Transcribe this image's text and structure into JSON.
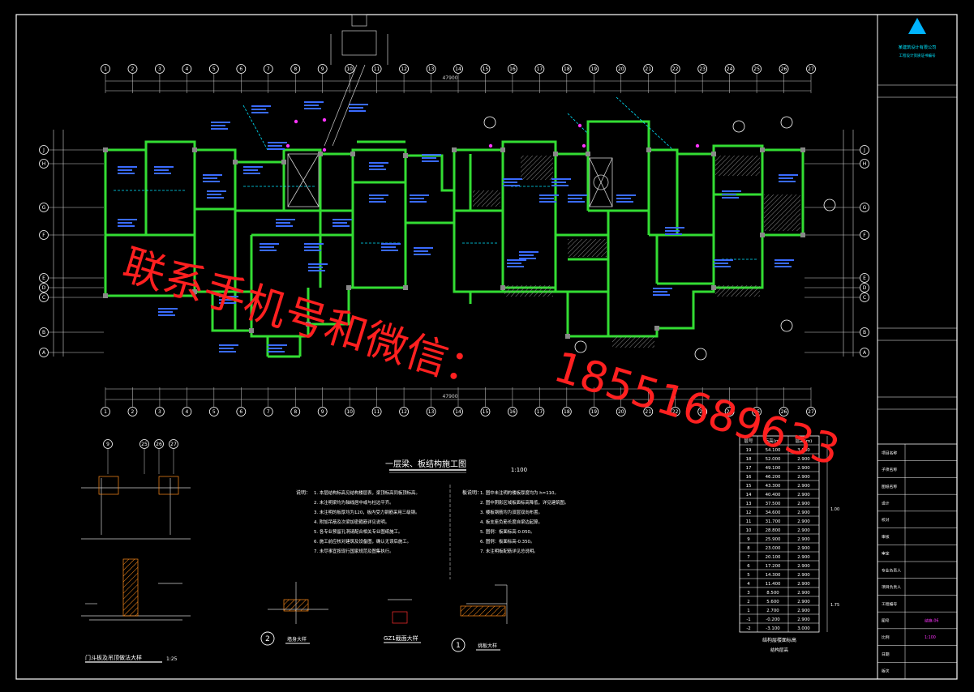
{
  "colors": {
    "background": "#000000",
    "frame": "#ffffff",
    "wall": "#33dd33",
    "dim": "#cfcfcf",
    "label": "#3a6bff",
    "grid_bubble": "#ffffff",
    "watermark": "#ff2020",
    "column": "#888888",
    "accent": "#ff33ff",
    "section_hatch": "#ff8c1a",
    "symbol": "#00e5ff"
  },
  "watermark": {
    "line1": "联系手机号和微信：",
    "line2": "18551689633"
  },
  "plan": {
    "title": "一层梁、板结构施工图",
    "scale": "1:100",
    "dim_total_top": "47900",
    "dim_total_bottom": "47900",
    "grid_top": [
      "1",
      "2",
      "3",
      "4",
      "5",
      "6",
      "7",
      "8",
      "9",
      "10",
      "11",
      "12",
      "13",
      "14",
      "15",
      "16",
      "17",
      "18",
      "19",
      "20",
      "21",
      "22",
      "23",
      "24",
      "25",
      "26",
      "27"
    ],
    "grid_bottom": [
      "1",
      "2",
      "3",
      "4",
      "5",
      "6",
      "7",
      "8",
      "9",
      "10",
      "11",
      "12",
      "13",
      "14",
      "15",
      "16",
      "17",
      "18",
      "19",
      "20",
      "21",
      "22",
      "23",
      "24",
      "25",
      "26",
      "27"
    ],
    "grid_side": [
      "J",
      "H",
      "G",
      "F",
      "E",
      "D",
      "C",
      "B",
      "A"
    ]
  },
  "notes": {
    "left_head": "说明：",
    "left": [
      "1. 本层结构标高见结构楼层表，梁顶标高同板顶标高。",
      "2. 未注明梁均为轴线居中或与柱边平齐。",
      "3. 未注明的板厚均为120，板内受力钢筋采用三级钢。",
      "4. 附加吊筋及次梁加密箍筋详见说明。",
      "5. 各专业预留孔洞请配合相关专业图纸施工。",
      "6. 施工前应核对建筑及设备图，确认无误后施工。",
      "7. 未尽事宜按现行国家规范及图集执行。"
    ],
    "right_head": "板说明：",
    "right": [
      "1. 图中未注明的楼板厚度均为 h=110。",
      "2. 图中阴影区域板面标高降低，详见建筑图。",
      "3. 楼板钢筋均为双层双向布置。",
      "4. 板支座负筋长度自梁边起算。",
      "5. 图例：板面标高-0.050。",
      "6. 图例：板面标高-0.350。",
      "7. 未注明板配筋详见总说明。"
    ]
  },
  "details": [
    {
      "num": "2",
      "label": "墙身大样"
    },
    {
      "num": "",
      "label": "GZ1截面大样"
    },
    {
      "num": "1",
      "label": "挑板大样"
    }
  ],
  "detail_left_label": "门斗板及吊顶做法大样",
  "detail_left_scale": "1:25",
  "detail_left_dims": [
    "9",
    "25",
    "26",
    "27"
  ],
  "floor_table": {
    "header": [
      "层号",
      "标高(m)",
      "层高(m)"
    ],
    "rows": [
      [
        "19",
        "54.100",
        "3.000"
      ],
      [
        "18",
        "52.000",
        "2.900"
      ],
      [
        "17",
        "49.100",
        "2.900"
      ],
      [
        "16",
        "46.200",
        "2.900"
      ],
      [
        "15",
        "43.300",
        "2.900"
      ],
      [
        "14",
        "40.400",
        "2.900"
      ],
      [
        "13",
        "37.500",
        "2.900"
      ],
      [
        "12",
        "34.600",
        "2.900"
      ],
      [
        "11",
        "31.700",
        "2.900"
      ],
      [
        "10",
        "28.800",
        "2.900"
      ],
      [
        "9",
        "25.900",
        "2.900"
      ],
      [
        "8",
        "23.000",
        "2.900"
      ],
      [
        "7",
        "20.100",
        "2.900"
      ],
      [
        "6",
        "17.200",
        "2.900"
      ],
      [
        "5",
        "14.300",
        "2.900"
      ],
      [
        "4",
        "11.400",
        "2.900"
      ],
      [
        "3",
        "8.500",
        "2.900"
      ],
      [
        "2",
        "5.600",
        "2.900"
      ],
      [
        "1",
        "2.700",
        "2.900"
      ],
      [
        "-1",
        "-0.200",
        "2.900"
      ],
      [
        "-2",
        "-3.100",
        "3.000"
      ]
    ],
    "caption": "结构层楼面标高",
    "caption2": "结构层高",
    "side_label1": "1.00",
    "side_label2": "1.75"
  },
  "title_block": {
    "company": "某建筑设计有限公司",
    "sub": "工程设计资质证书编号",
    "rows": [
      "项目名称",
      "子项名称",
      "图纸名称",
      "设计",
      "校对",
      "审核",
      "审定",
      "专业负责人",
      "项目负责人",
      "工程编号",
      "图号",
      "比例",
      "日期",
      "版次"
    ],
    "values": [
      "",
      "",
      "",
      "",
      "",
      "",
      "",
      "",
      "",
      "",
      "结施-06",
      "1:100",
      "",
      ""
    ]
  }
}
